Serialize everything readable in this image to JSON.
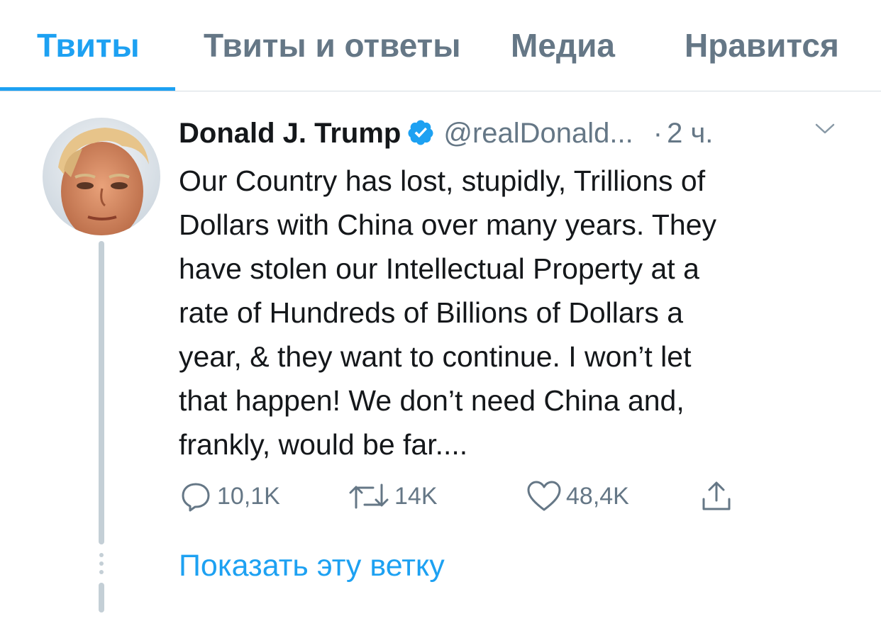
{
  "tabs": [
    {
      "label": "Твиты",
      "active": true
    },
    {
      "label": "Твиты и ответы",
      "active": false
    },
    {
      "label": "Медиа",
      "active": false
    },
    {
      "label": "Нравится",
      "active": false
    }
  ],
  "tweet": {
    "author_name": "Donald J. Trump",
    "handle": "@realDonald...",
    "separator": "·",
    "time": "2 ч.",
    "text_lines": [
      "Our Country has lost, stupidly, Trillions of",
      "Dollars with China over many years. They",
      "have stolen our Intellectual Property at a",
      "rate of Hundreds of Billions of Dollars a",
      "year, & they want to continue. I won’t let",
      "that happen! We don’t need China and,",
      "frankly, would be far...."
    ],
    "actions": {
      "reply_count": "10,1K",
      "retweet_count": "14K",
      "like_count": "48,4K"
    },
    "show_thread": "Показать эту ветку"
  },
  "colors": {
    "accent": "#1da1f2",
    "secondary_text": "#657786",
    "primary_text": "#14171a"
  },
  "icons": [
    "verified-badge-icon",
    "chevron-down-icon",
    "reply-icon",
    "retweet-icon",
    "like-icon",
    "share-icon"
  ]
}
